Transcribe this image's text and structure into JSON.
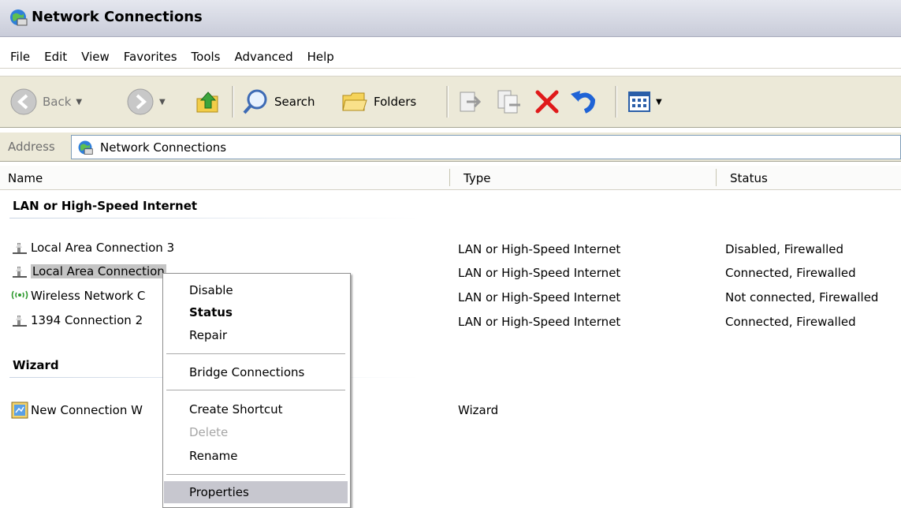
{
  "window": {
    "title": "Network Connections"
  },
  "menu": [
    "File",
    "Edit",
    "View",
    "Favorites",
    "Tools",
    "Advanced",
    "Help"
  ],
  "toolbar": {
    "back": "Back",
    "search": "Search",
    "folders": "Folders"
  },
  "address": {
    "label": "Address",
    "value": "Network Connections"
  },
  "columns": {
    "name": "Name",
    "type": "Type",
    "status": "Status"
  },
  "groups": {
    "lan": {
      "title": "LAN or High-Speed Internet",
      "items": [
        {
          "name": "Local Area Connection 3",
          "type": "LAN or High-Speed Internet",
          "status": "Disabled, Firewalled"
        },
        {
          "name": "Local Area Connection",
          "type": "LAN or High-Speed Internet",
          "status": "Connected, Firewalled"
        },
        {
          "name": "Wireless Network C",
          "type": "LAN or High-Speed Internet",
          "status": "Not connected, Firewalled"
        },
        {
          "name": "1394 Connection 2",
          "type": "LAN or High-Speed Internet",
          "status": "Connected, Firewalled"
        }
      ]
    },
    "wizard": {
      "title": "Wizard",
      "items": [
        {
          "name": "New Connection W",
          "type": "Wizard",
          "status": ""
        }
      ]
    }
  },
  "context_menu": {
    "disable": "Disable",
    "status": "Status",
    "repair": "Repair",
    "bridge": "Bridge Connections",
    "shortcut": "Create Shortcut",
    "delete": "Delete",
    "rename": "Rename",
    "properties": "Properties"
  },
  "colors": {
    "selection": "#c4c4c4",
    "menu_highlight": "#c7c7cf",
    "toolbar_bg": "#ece9d8",
    "delete_red": "#e01a1a",
    "undo_blue": "#1f63d6"
  }
}
